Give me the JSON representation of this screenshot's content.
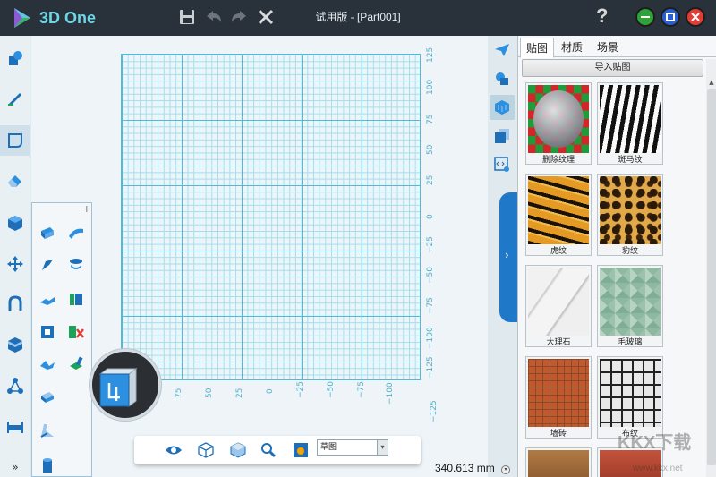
{
  "app": {
    "name": "3D One",
    "window_title": "试用版 - [Part001]",
    "help_label": "?"
  },
  "titlebar": {
    "icons": [
      "save-icon",
      "undo-icon",
      "redo-icon",
      "close-x-icon"
    ],
    "window_buttons": [
      {
        "name": "minimize",
        "color": "#2fa33a"
      },
      {
        "name": "maximize",
        "color": "#2a5fd0"
      },
      {
        "name": "close",
        "color": "#e13d37"
      }
    ]
  },
  "left_toolbar": {
    "items": [
      "primitive-shapes-icon",
      "sketch-pen-icon",
      "sketch-icon",
      "eraser-icon",
      "solid-cube-icon",
      "move-icon",
      "magnet-icon",
      "box-icon",
      "network-icon",
      "ruler-icon"
    ],
    "active_index": 2,
    "more_label": "»"
  },
  "flyout_tools": {
    "pin_label": "⊣",
    "items": [
      "extrude-icon",
      "sweep-icon",
      "revolve-icon",
      "loft-icon",
      "fillet-icon",
      "chamfer-icon",
      "shell-icon",
      "delete-face-icon",
      "twist-icon",
      "cut-icon",
      "draft-icon",
      "split-icon",
      "pipe-icon"
    ]
  },
  "grid": {
    "right_ticks": [
      "125",
      "100",
      "75",
      "50",
      "25",
      "0",
      "−25",
      "−50",
      "−75",
      "−100",
      "−125"
    ],
    "bottom_ticks": [
      "75",
      "50",
      "25",
      "0",
      "−25",
      "−50",
      "−75",
      "−100",
      "−125"
    ]
  },
  "bottom_toolbar": {
    "icons": [
      "eye-icon",
      "wireframe-cube-icon",
      "shaded-cube-icon",
      "zoom-icon",
      "render-mode-icon"
    ],
    "select_value": "草图",
    "measurement": "340.613 mm"
  },
  "right_strip": {
    "icons": [
      "send-icon",
      "materials-icon",
      "texture-cube-icon",
      "stack-cube-icon",
      "code-icon"
    ],
    "active_index": 2,
    "collapse_arrow": "›"
  },
  "panel": {
    "tabs": [
      "贴图",
      "材质",
      "场景"
    ],
    "active_tab": 0,
    "import_button": "导入贴图",
    "textures": [
      {
        "label": "删除纹理",
        "kind": "clear"
      },
      {
        "label": "斑马纹",
        "kind": "zebra"
      },
      {
        "label": "虎纹",
        "kind": "tiger"
      },
      {
        "label": "豹纹",
        "kind": "leopard"
      },
      {
        "label": "大理石",
        "kind": "marble"
      },
      {
        "label": "毛玻璃",
        "kind": "glass"
      },
      {
        "label": "墙砖",
        "kind": "brick"
      },
      {
        "label": "布纹",
        "kind": "plaid"
      }
    ]
  },
  "watermark": {
    "text": "KKX下载",
    "sub": "www.kkx.net"
  }
}
